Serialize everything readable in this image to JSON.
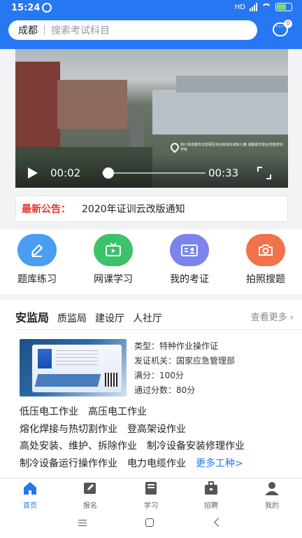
{
  "status": {
    "time": "15:24",
    "network": "HD"
  },
  "header": {
    "city": "成都",
    "search_placeholder": "搜索考试科目",
    "message_badge": "0"
  },
  "video": {
    "caption": "四川省成都市龙泉驿区柏合街道车城东七路 成都航天职业技能培训学校",
    "current_time": "00:02",
    "duration": "00:33",
    "progress": 0.06
  },
  "notice": {
    "label": "最新公告：",
    "text": "2020年证训云改版通知"
  },
  "features": [
    {
      "label": "题库练习",
      "icon": "pencil-icon",
      "color": "#4a9df0"
    },
    {
      "label": "网课学习",
      "icon": "tv-icon",
      "color": "#3cc268"
    },
    {
      "label": "我的考证",
      "icon": "id-card-icon",
      "color": "#7b84ea"
    },
    {
      "label": "拍照搜题",
      "icon": "camera-icon",
      "color": "#f2724c"
    }
  ],
  "category_tabs": [
    "安监局",
    "质监局",
    "建设厅",
    "人社厅"
  ],
  "more_label": "查看更多",
  "certificate": {
    "type": "类型：特种作业操作证",
    "issuer": "发证机关：国家应急管理部",
    "full_score": "满分：100分",
    "pass_score": "通过分数：80分"
  },
  "jobs": [
    "低压电工作业",
    "高压电工作业",
    "熔化焊接与热切割作业",
    "登高架设作业",
    "高处安装、维护、拆除作业",
    "制冷设备安装修理作业",
    "制冷设备运行操作作业",
    "电力电缆作业"
  ],
  "jobs_more": "更多工种>",
  "nav": [
    {
      "label": "首页",
      "icon": "home-icon",
      "active": true
    },
    {
      "label": "报名",
      "icon": "edit-icon",
      "active": false
    },
    {
      "label": "学习",
      "icon": "book-icon",
      "active": false
    },
    {
      "label": "招聘",
      "icon": "briefcase-icon",
      "active": false
    },
    {
      "label": "我的",
      "icon": "user-icon",
      "active": false
    }
  ],
  "colors": {
    "brand": "#2677f1",
    "notice_red": "#e8322c"
  }
}
